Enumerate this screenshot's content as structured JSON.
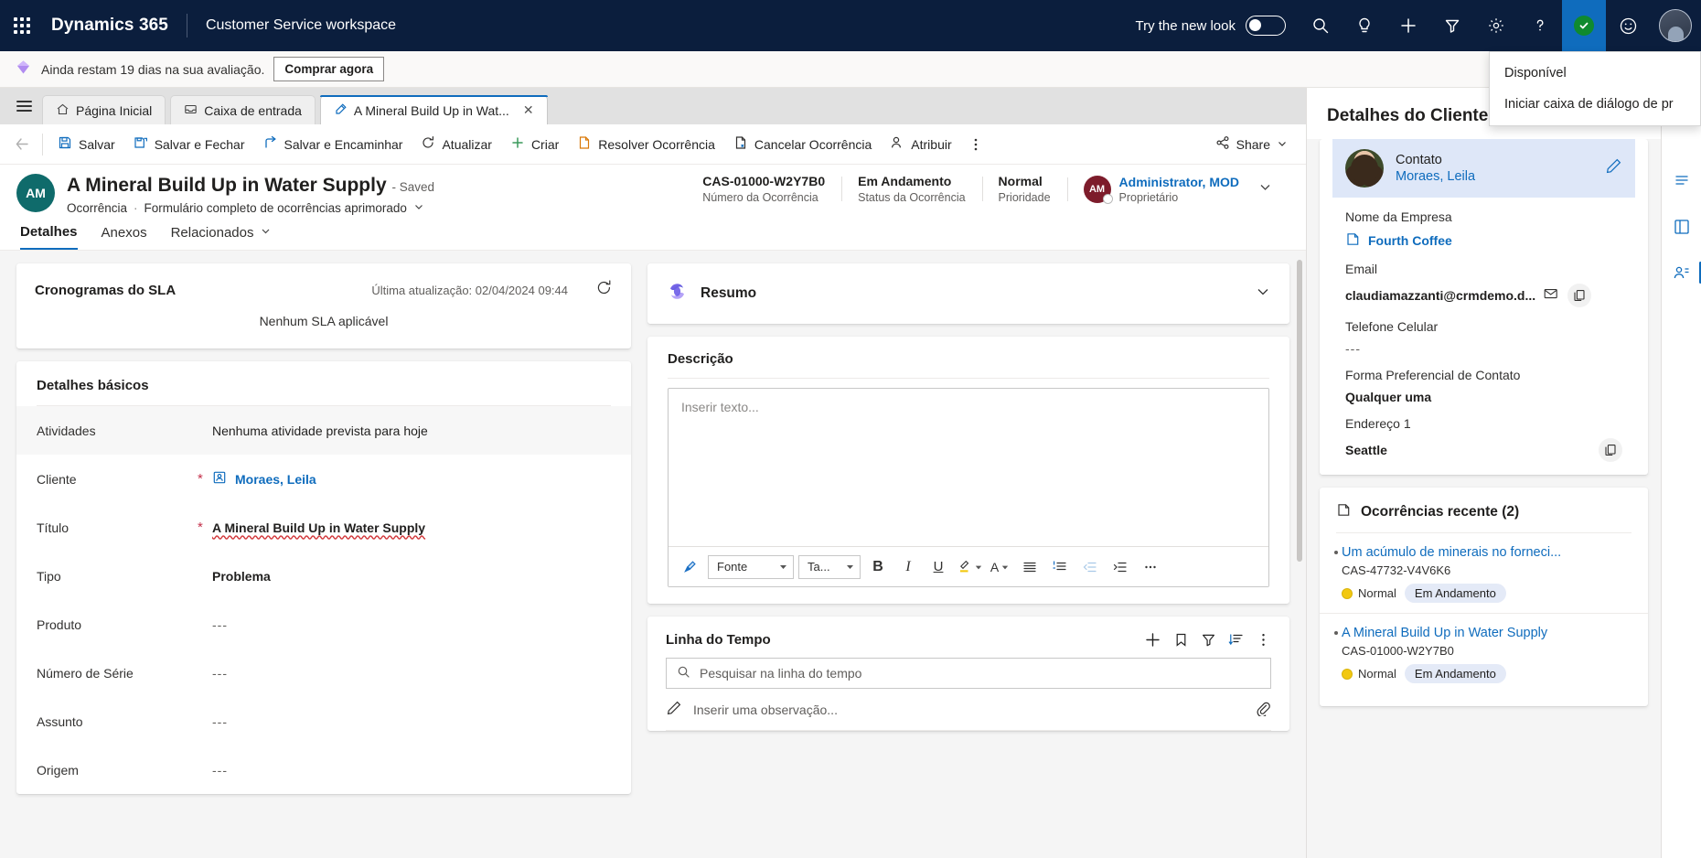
{
  "topnav": {
    "brand": "Dynamics 365",
    "app_name": "Customer Service workspace",
    "new_look_label": "Try the new look",
    "new_look_on": false,
    "icons": [
      "search-icon",
      "lightbulb-icon",
      "plus-icon",
      "filter-icon",
      "gear-icon",
      "help-icon",
      "presence-available-icon",
      "feedback-smiley-icon",
      "user-avatar"
    ],
    "presence_menu": {
      "status": "Disponível",
      "action": "Iniciar caixa de diálogo de pr"
    }
  },
  "trialbar": {
    "message": "Ainda restam 19 dias na sua avaliação.",
    "buy_label": "Comprar agora"
  },
  "tabs": [
    {
      "label": "Página Inicial",
      "icon": "home-icon",
      "active": false,
      "closable": false
    },
    {
      "label": "Caixa de entrada",
      "icon": "inbox-icon",
      "active": false,
      "closable": false
    },
    {
      "label": "A Mineral Build Up in Wat...",
      "icon": "case-icon",
      "active": true,
      "closable": true
    }
  ],
  "commandbar": {
    "back": "back-arrow-icon",
    "items": [
      {
        "label": "Salvar",
        "icon": "save-icon"
      },
      {
        "label": "Salvar e Fechar",
        "icon": "save-close-icon"
      },
      {
        "label": "Salvar e Encaminhar",
        "icon": "save-route-icon"
      },
      {
        "label": "Atualizar",
        "icon": "refresh-icon"
      },
      {
        "label": "Criar",
        "icon": "plus-icon"
      },
      {
        "label": "Resolver Ocorrência",
        "icon": "resolve-case-icon"
      },
      {
        "label": "Cancelar Ocorrência",
        "icon": "cancel-case-icon"
      },
      {
        "label": "Atribuir",
        "icon": "assign-person-icon"
      }
    ],
    "overflow": "more-ellipsis-icon",
    "share_label": "Share"
  },
  "record_header": {
    "avatar_initials": "AM",
    "title": "A Mineral Build Up in Water Supply",
    "saved_state": "- Saved",
    "entity": "Ocorrência",
    "form_name": "Formulário completo de ocorrências aprimorado",
    "fields": [
      {
        "value": "CAS-01000-W2Y7B0",
        "label": "Número da Ocorrência"
      },
      {
        "value": "Em Andamento",
        "label": "Status da Ocorrência"
      },
      {
        "value": "Normal",
        "label": "Prioridade"
      }
    ],
    "owner": {
      "initials": "AM",
      "name": "Administrator, MOD",
      "role": "Proprietário"
    }
  },
  "form_tabs": [
    {
      "label": "Detalhes",
      "active": true,
      "chevron": false
    },
    {
      "label": "Anexos",
      "active": false,
      "chevron": false
    },
    {
      "label": "Relacionados",
      "active": false,
      "chevron": true
    }
  ],
  "sla": {
    "title": "Cronogramas do SLA",
    "last_update": "Última atualização: 02/04/2024 09:44",
    "refresh_icon": "refresh-icon",
    "empty_text": "Nenhum SLA aplicável"
  },
  "basic_details": {
    "section_title": "Detalhes básicos",
    "rows": [
      {
        "label": "Atividades",
        "value": "Nenhuma atividade prevista para hoje",
        "required": false,
        "style": "plain",
        "alt": true
      },
      {
        "label": "Cliente",
        "value": "Moraes, Leila",
        "required": true,
        "style": "link",
        "icon": "contact-icon",
        "alt": false
      },
      {
        "label": "Título",
        "value": "A Mineral Build Up in Water Supply",
        "required": true,
        "style": "spell",
        "alt": false
      },
      {
        "label": "Tipo",
        "value": "Problema",
        "required": false,
        "style": "bold",
        "alt": false
      },
      {
        "label": "Produto",
        "value": "---",
        "required": false,
        "style": "muted",
        "alt": false
      },
      {
        "label": "Número de Série",
        "value": "---",
        "required": false,
        "style": "muted",
        "alt": false
      },
      {
        "label": "Assunto",
        "value": "---",
        "required": false,
        "style": "muted",
        "alt": false
      },
      {
        "label": "Origem",
        "value": "---",
        "required": false,
        "style": "muted",
        "alt": false
      }
    ]
  },
  "resumo": {
    "title": "Resumo",
    "icon": "copilot-icon",
    "chevron": "chevron-down-icon"
  },
  "descricao": {
    "title": "Descrição",
    "placeholder": "Inserir texto...",
    "toolbar": {
      "format_painter": "format-painter-icon",
      "font_label": "Fonte",
      "size_label": "Ta...",
      "bold": "B",
      "italic": "I",
      "underline": "U",
      "highlight": "highlight-icon",
      "font_color": "A",
      "bullet_list": "bullet-list-icon",
      "numbered_list": "numbered-list-icon",
      "outdent": "outdent-icon",
      "indent": "indent-icon",
      "more": "more-ellipsis-icon"
    }
  },
  "timeline": {
    "title": "Linha do Tempo",
    "actions": [
      "plus-icon",
      "bookmark-icon",
      "filter-icon",
      "sort-icon",
      "more-vertical-icon"
    ],
    "search_placeholder": "Pesquisar na linha do tempo",
    "note_placeholder": "Inserir uma observação...",
    "attach_icon": "paperclip-icon"
  },
  "customer_panel": {
    "header": "Detalhes do Cliente",
    "contact": {
      "type_label": "Contato",
      "name": "Moraes, Leila",
      "edit_icon": "pencil-icon",
      "photo": "contact-photo"
    },
    "fields": [
      {
        "label": "Nome da Empresa",
        "value": "Fourth Coffee",
        "style": "link",
        "icon": "account-icon"
      },
      {
        "label": "Email",
        "value": "claudiamazzanti@crmdemo.d...",
        "style": "bold",
        "mail_icon": "mail-icon",
        "copy_icon": "copy-icon"
      },
      {
        "label": "Telefone Celular",
        "value": "---",
        "style": "dash"
      },
      {
        "label": "Forma Preferencial de Contato",
        "value": "Qualquer uma",
        "style": "bold"
      },
      {
        "label": "Endereço 1",
        "value": "Seattle",
        "style": "bold",
        "copy_icon": "copy-icon"
      }
    ],
    "recent_cases": {
      "title": "Ocorrências recente (2)",
      "icon": "case-icon",
      "items": [
        {
          "title": "Um acúmulo de minerais no forneci...",
          "number": "CAS-47732-V4V6K6",
          "priority": "Normal",
          "status": "Em Andamento"
        },
        {
          "title": "A Mineral Build Up in Water Supply",
          "number": "CAS-01000-W2Y7B0",
          "priority": "Normal",
          "status": "Em Andamento"
        }
      ]
    }
  },
  "rail_icons": [
    "notes-panel-icon",
    "knowledge-panel-icon",
    "relationship-panel-icon"
  ],
  "colors": {
    "nav_bg": "#0b1e3d",
    "accent": "#0f6cbd",
    "presence_green": "#0f8a2f",
    "required_red": "#c4314b",
    "priority_yellow": "#f2c811",
    "badge_bg": "#e4eaf7"
  }
}
